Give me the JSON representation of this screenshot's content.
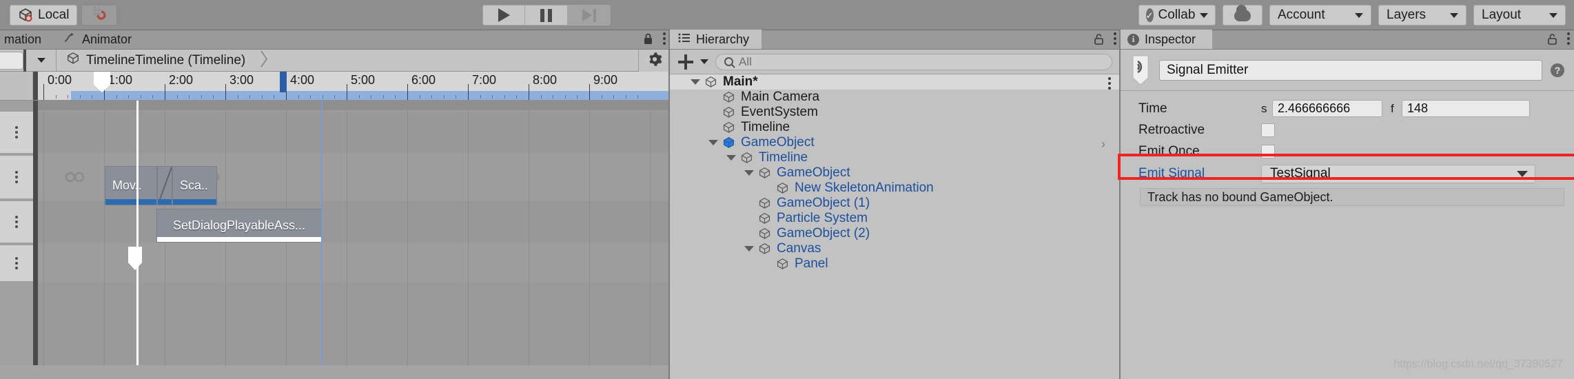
{
  "toolbar": {
    "pivot_button": {
      "label": "Local",
      "icon": "cube-pivot-icon"
    },
    "snap_button": {
      "icon": "grid-snap-icon"
    },
    "play_button": {
      "icon": "play-icon"
    },
    "pause_button": {
      "icon": "pause-icon"
    },
    "step_button": {
      "icon": "step-forward-icon"
    },
    "collab": {
      "label": "Collab",
      "icon": "collab-check-icon"
    },
    "cloud": {
      "icon": "cloud-icon"
    },
    "account": {
      "label": "Account"
    },
    "layers": {
      "label": "Layers"
    },
    "layout": {
      "label": "Layout"
    }
  },
  "timeline": {
    "tabs": [
      {
        "label": "mation",
        "active": false
      },
      {
        "label": "Animator",
        "active": false
      }
    ],
    "breadcrumb": {
      "title": "TimelineTimeline (Timeline)"
    },
    "ruler": {
      "labels": [
        "0:00",
        "1:00",
        "2:00",
        "3:00",
        "4:00",
        "5:00",
        "6:00",
        "7:00",
        "8:00",
        "9:00"
      ],
      "playhead_time": "2:30",
      "blue_marker_time": "3:52"
    },
    "clips": [
      {
        "label": "Mov..",
        "track": 2
      },
      {
        "label": "Sca..",
        "track": 2
      },
      {
        "label": "SetDialogPlayableAss...",
        "track": 3
      }
    ],
    "track_count": 4
  },
  "hierarchy": {
    "tab_label": "Hierarchy",
    "tab_icon": "hierarchy-list-icon",
    "create_label": "+",
    "search": {
      "placeholder": "All",
      "value": ""
    },
    "rows": [
      {
        "label": "Main*",
        "depth": 0,
        "expanded": true,
        "color": "black",
        "bold": true,
        "scene": true,
        "kebab": true
      },
      {
        "label": "Main Camera",
        "depth": 1,
        "expanded": null,
        "color": "black",
        "bold": false,
        "scene": false,
        "kebab": false
      },
      {
        "label": "EventSystem",
        "depth": 1,
        "expanded": null,
        "color": "black",
        "bold": false,
        "scene": false,
        "kebab": false
      },
      {
        "label": "Timeline",
        "depth": 1,
        "expanded": null,
        "color": "black",
        "bold": false,
        "scene": false,
        "kebab": false
      },
      {
        "label": "GameObject",
        "depth": 1,
        "expanded": true,
        "color": "blue",
        "bold": false,
        "scene": false,
        "kebab": false,
        "chevron": true,
        "selected_icon": true
      },
      {
        "label": "Timeline",
        "depth": 2,
        "expanded": true,
        "color": "blue",
        "bold": false,
        "scene": false,
        "kebab": false
      },
      {
        "label": "GameObject",
        "depth": 3,
        "expanded": true,
        "color": "blue",
        "bold": false,
        "scene": false,
        "kebab": false
      },
      {
        "label": "New SkeletonAnimation",
        "depth": 4,
        "expanded": null,
        "color": "blue",
        "bold": false,
        "scene": false,
        "kebab": false
      },
      {
        "label": "GameObject (1)",
        "depth": 3,
        "expanded": null,
        "color": "blue",
        "bold": false,
        "scene": false,
        "kebab": false
      },
      {
        "label": "Particle System",
        "depth": 3,
        "expanded": null,
        "color": "blue",
        "bold": false,
        "scene": false,
        "kebab": false
      },
      {
        "label": "GameObject (2)",
        "depth": 3,
        "expanded": null,
        "color": "blue",
        "bold": false,
        "scene": false,
        "kebab": false
      },
      {
        "label": "Canvas",
        "depth": 3,
        "expanded": true,
        "color": "blue",
        "bold": false,
        "scene": false,
        "kebab": false
      },
      {
        "label": "Panel",
        "depth": 4,
        "expanded": null,
        "color": "blue",
        "bold": false,
        "scene": false,
        "kebab": false
      }
    ]
  },
  "inspector": {
    "tab_label": "Inspector",
    "component_icon": "signal-emitter-icon",
    "name_value": "Signal Emitter",
    "help_icon": "help-icon",
    "properties": {
      "time_label": "Time",
      "time_unit_seconds": "s",
      "time_seconds_value": "2.466666666",
      "time_unit_frames": "f",
      "time_frames_value": "148",
      "retroactive_label": "Retroactive",
      "retroactive_checked": false,
      "emit_once_label": "Emit Once",
      "emit_once_checked": false,
      "emit_signal_label": "Emit Signal",
      "emit_signal_value": "TestSignal"
    },
    "warning": "Track has no bound GameObject.",
    "highlight_color": "#f02424"
  },
  "watermark": "https://blog.csdn.net/qq_37390527"
}
